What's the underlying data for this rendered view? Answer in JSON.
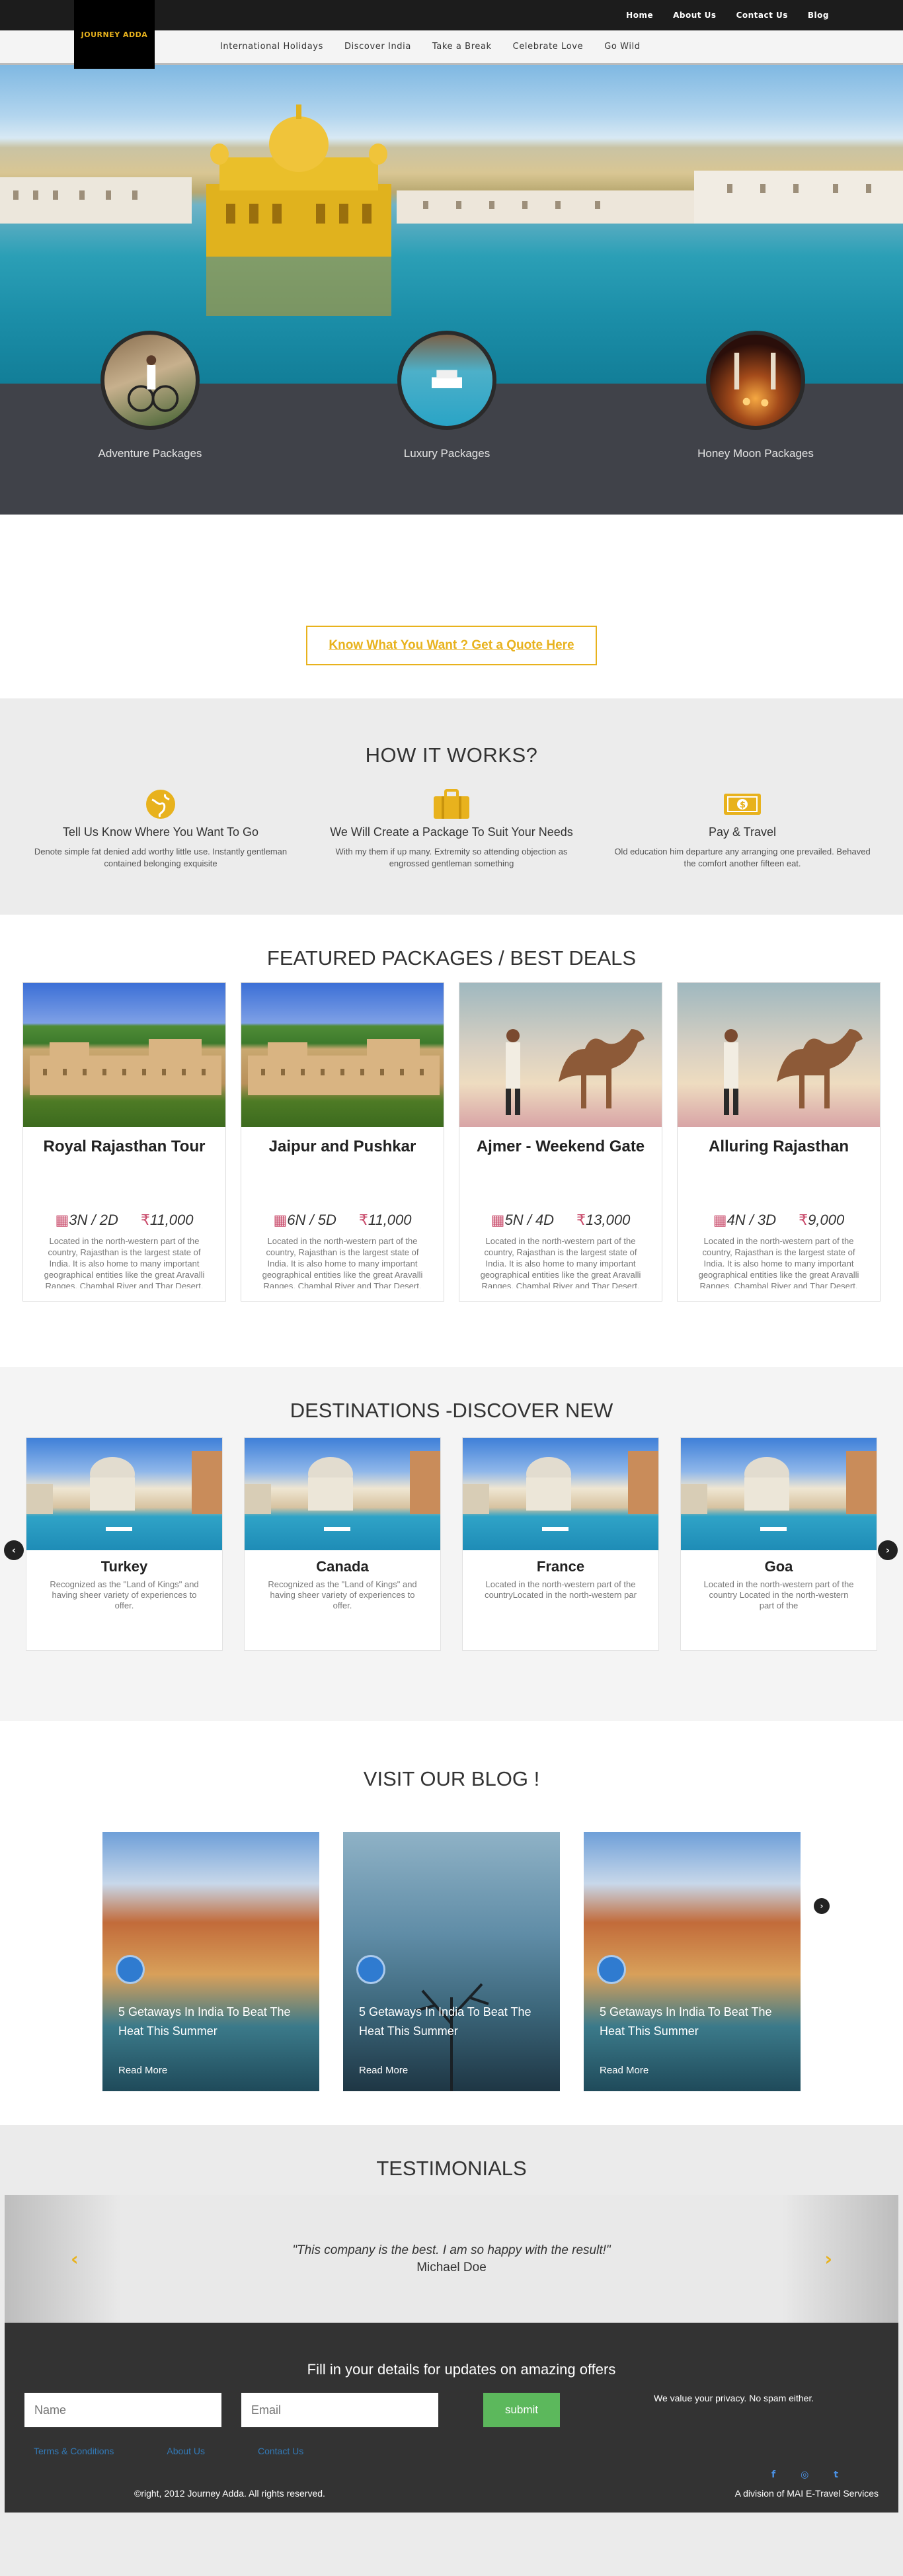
{
  "brand": {
    "logo_text": "JOURNEY ADDA"
  },
  "topnav": [
    "Home",
    "About Us",
    "Contact Us",
    "Blog"
  ],
  "subnav": [
    "International Holidays",
    "Discover India",
    "Take a Break",
    "Celebrate Love",
    "Go Wild"
  ],
  "packages": [
    "Adventure Packages",
    "Luxury Packages",
    "Honey Moon Packages"
  ],
  "quote_button": "Know What You Want ? Get a Quote Here",
  "how": {
    "title": "HOW IT WORKS?",
    "steps": [
      {
        "title": "Tell Us Know Where You Want To Go",
        "text": "Denote simple fat denied add worthy little use. Instantly gentleman contained belonging exquisite",
        "icon": "globe-icon"
      },
      {
        "title": "We Will Create a Package To Suit Your Needs",
        "text": "With my them if up many. Extremity so attending objection as engrossed gentleman something",
        "icon": "briefcase-icon"
      },
      {
        "title": "Pay & Travel",
        "text": "Old education him departure any arranging one prevailed. Behaved the comfort another fifteen eat.",
        "icon": "money-icon"
      }
    ]
  },
  "featured": {
    "title": "FEATURED PACKAGES / BEST DEALS",
    "cards": [
      {
        "title": "Royal Rajasthan Tour",
        "duration": "3N / 2D",
        "price": "11,000",
        "text": "Located in the north-western part of the country, Rajasthan is the largest state of India. It is also home to many important geographical entities like the great Aravalli Ranges, Chambal River and Thar Desert."
      },
      {
        "title": "Jaipur and Pushkar",
        "duration": "6N / 5D",
        "price": "11,000",
        "text": "Located in the north-western part of the country, Rajasthan is the largest state of India. It is also home to many important geographical entities like the great Aravalli Ranges, Chambal River and Thar Desert."
      },
      {
        "title": "Ajmer - Weekend Gate",
        "duration": "5N / 4D",
        "price": "13,000",
        "text": "Located in the north-western part of the country, Rajasthan is the largest state of India. It is also home to many important geographical entities like the great Aravalli Ranges, Chambal River and Thar Desert."
      },
      {
        "title": "Alluring Rajasthan",
        "duration": "4N / 3D",
        "price": "9,000",
        "text": "Located in the north-western part of the country, Rajasthan is the largest state of India. It is also home to many important geographical entities like the great Aravalli Ranges, Chambal River and Thar Desert."
      }
    ]
  },
  "destinations": {
    "title": "DESTINATIONS -DISCOVER NEW",
    "cards": [
      {
        "title": "Turkey",
        "text": "Recognized as the \"Land of Kings\" and having sheer variety of experiences to offer."
      },
      {
        "title": "Canada",
        "text": "Recognized as the \"Land of Kings\" and having sheer variety of experiences to offer."
      },
      {
        "title": "France",
        "text": "Located in the north-western part of the countryLocated in the north-western par"
      },
      {
        "title": "Goa",
        "text": "Located in the north-western part of the country Located in the north-western part of the"
      }
    ]
  },
  "blog": {
    "title": "VISIT OUR BLOG !",
    "posts": [
      {
        "title": "5 Getaways In India To Beat The Heat This Summer",
        "link": "Read More"
      },
      {
        "title": "5 Getaways In India To Beat The Heat This Summer",
        "link": "Read More"
      },
      {
        "title": "5 Getaways In India To Beat The Heat This Summer",
        "link": "Read More"
      }
    ]
  },
  "testimonials": {
    "title": "TESTIMONIALS",
    "quote": "\"This company is the best. I am so happy with the result!\"",
    "author": "Michael Doe"
  },
  "footer": {
    "heading": "Fill in your details for updates on amazing offers",
    "name_placeholder": "Name",
    "email_placeholder": "Email",
    "submit": "submit",
    "privacy": "We value your privacy. No spam either.",
    "links": [
      "Terms & Conditions",
      "About Us",
      "Contact Us"
    ],
    "social": [
      "f",
      "◎",
      "t"
    ],
    "copyright": "©right, 2012 Journey Adda. All rights reserved.",
    "division": "A division of MAI E-Travel Services"
  }
}
